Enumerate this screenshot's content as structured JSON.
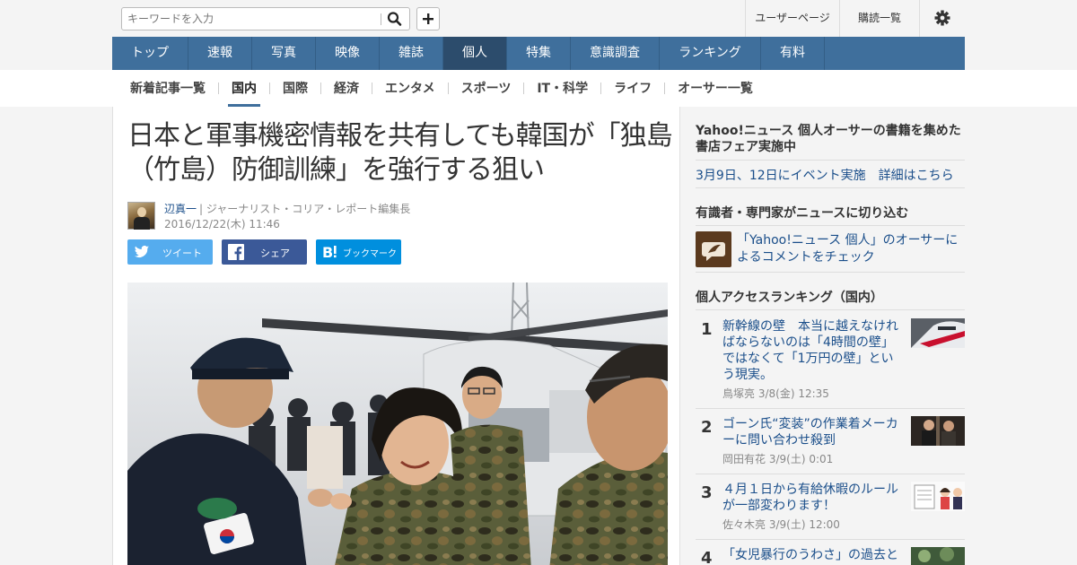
{
  "search": {
    "placeholder": "キーワードを入力"
  },
  "toplinks": {
    "user_page": "ユーザーページ",
    "subscriptions": "購読一覧"
  },
  "main_nav": [
    "トップ",
    "速報",
    "写真",
    "映像",
    "雑誌",
    "個人",
    "特集",
    "意識調査",
    "ランキング",
    "有料"
  ],
  "main_nav_active": "個人",
  "sub_nav": [
    "新着記事一覧",
    "国内",
    "国際",
    "経済",
    "エンタメ",
    "スポーツ",
    "IT・科学",
    "ライフ",
    "オーサー一覧"
  ],
  "sub_nav_active": "国内",
  "article": {
    "title": "日本と軍事機密情報を共有しても韓国が「独島（竹島）防御訓練」を強行する狙い",
    "author": "辺真一",
    "profile": "| ジャーナリスト・コリア・レポート編集長",
    "date": "2016/12/22(木) 11:46",
    "share": {
      "tweet": "ツイート",
      "facebook": "シェア",
      "bookmark": "ブックマーク"
    }
  },
  "sidebar": {
    "fair": {
      "title": "Yahoo!ニュース 個人オーサーの書籍を集めた書店フェア実施中",
      "link": "3月9日、12日にイベント実施　詳細はこちら"
    },
    "experts": {
      "title": "有識者・専門家がニュースに切り込む",
      "link": "「Yahoo!ニュース 個人」のオーサーによるコメントをチェック"
    },
    "ranking": {
      "title": "個人アクセスランキング（国内）",
      "items": [
        {
          "rank": "1",
          "title": "新幹線の壁　本当に越えなければならないのは「4時間の壁」ではなくて「1万円の壁」という現実。",
          "author": "鳥塚亮",
          "date": "3/8(金) 12:35"
        },
        {
          "rank": "2",
          "title": "ゴーン氏“変装”の作業着メーカーに問い合わせ殺到",
          "author": "岡田有花",
          "date": "3/9(土) 0:01"
        },
        {
          "rank": "3",
          "title": "４月１日から有給休暇のルールが一部変わります！",
          "author": "佐々木亮",
          "date": "3/9(土) 12:00"
        },
        {
          "rank": "4",
          "title": "「女児暴行のうわさ」の過去と",
          "author": "",
          "date": ""
        }
      ]
    }
  }
}
